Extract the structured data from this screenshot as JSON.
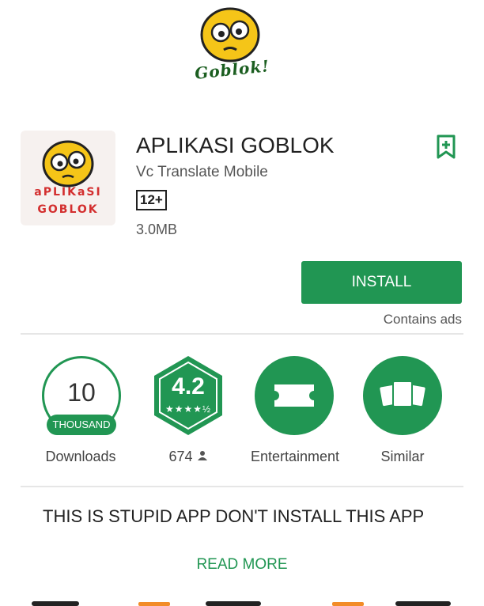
{
  "top_logo": {
    "text": "Goblok!"
  },
  "app": {
    "icon_line1": "aPLIKaSI",
    "icon_line2": "GOBLOK",
    "title": "APLIKASI GOBLOK",
    "developer": "Vc Translate Mobile",
    "content_rating": "12+",
    "size": "3.0MB"
  },
  "actions": {
    "install_label": "INSTALL",
    "contains_ads": "Contains ads"
  },
  "stats": {
    "downloads": {
      "number": "10",
      "unit": "THOUSAND",
      "caption": "Downloads"
    },
    "rating": {
      "value": "4.2",
      "stars": "★★★★½",
      "count": "674"
    },
    "category": {
      "caption": "Entertainment"
    },
    "similar": {
      "caption": "Similar"
    }
  },
  "description": {
    "text": "THIS IS STUPID APP DON'T INSTALL THIS APP",
    "read_more": "READ MORE"
  },
  "colors": {
    "accent": "#219653",
    "icon_text": "#d32f2f"
  }
}
